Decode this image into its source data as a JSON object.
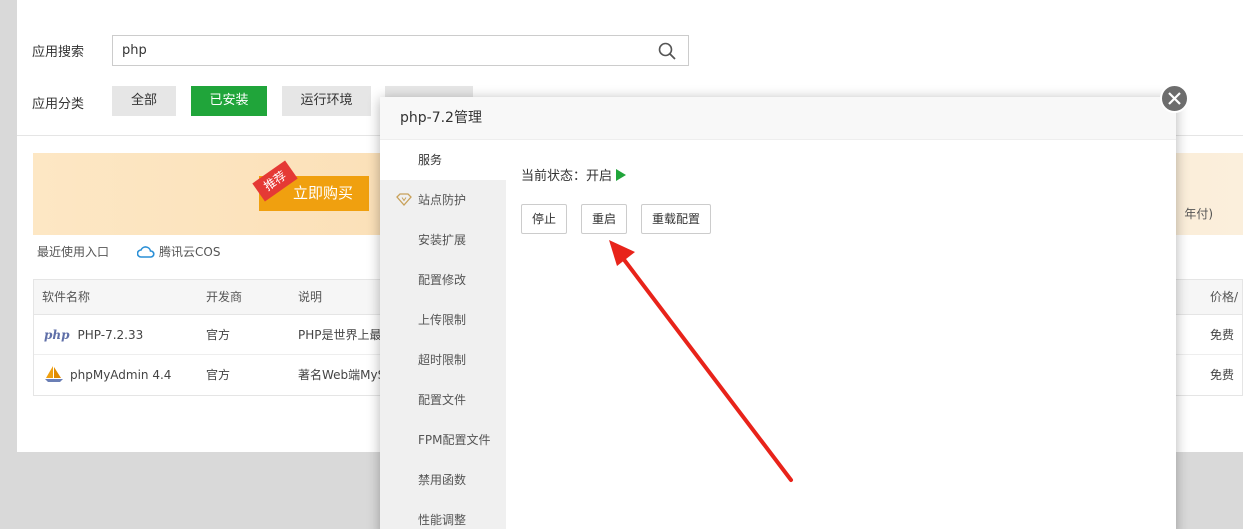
{
  "search": {
    "label": "应用搜索",
    "value": "php"
  },
  "categories": {
    "label": "应用分类",
    "items": [
      {
        "label": "全部",
        "active": false
      },
      {
        "label": "已安装",
        "active": true
      },
      {
        "label": "运行环境",
        "active": false
      }
    ]
  },
  "banner": {
    "ribbon": "推荐",
    "buy_label": "立即购买",
    "tail_text": "年付)"
  },
  "recent": {
    "label": "最近使用入口",
    "cos_label": "腾讯云COS"
  },
  "table": {
    "headers": [
      "软件名称",
      "开发商",
      "说明",
      "价格/"
    ],
    "rows": [
      {
        "logo": "php",
        "name": "PHP-7.2.33",
        "vendor": "官方",
        "desc": "PHP是世界上最",
        "price": "免费"
      },
      {
        "logo": "boat",
        "name": "phpMyAdmin 4.4",
        "vendor": "官方",
        "desc": "著名Web端MyS",
        "price": "免费"
      }
    ]
  },
  "modal": {
    "title": "php-7.2管理",
    "tabs": [
      {
        "label": "服务",
        "active": true
      },
      {
        "label": "站点防护",
        "active": false,
        "icon": "diamond-icon"
      },
      {
        "label": "安装扩展",
        "active": false
      },
      {
        "label": "配置修改",
        "active": false
      },
      {
        "label": "上传限制",
        "active": false
      },
      {
        "label": "超时限制",
        "active": false
      },
      {
        "label": "配置文件",
        "active": false
      },
      {
        "label": "FPM配置文件",
        "active": false
      },
      {
        "label": "禁用函数",
        "active": false
      },
      {
        "label": "性能调整",
        "active": false
      }
    ],
    "status_prefix": "当前状态：",
    "status_value": "开启",
    "buttons": {
      "stop": "停止",
      "restart": "重启",
      "reload": "重载配置"
    }
  },
  "colors": {
    "accent": "#20a53a",
    "buy": "#f0a00f",
    "arrow": "#e8231a"
  }
}
